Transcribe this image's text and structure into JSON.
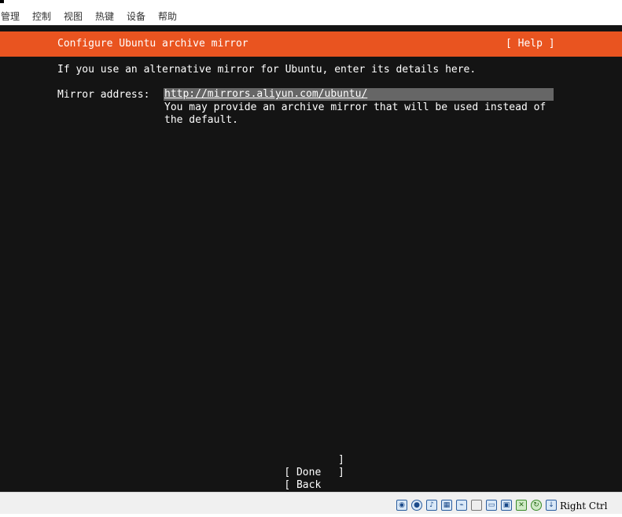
{
  "menubar": {
    "items": [
      "管理",
      "控制",
      "视图",
      "热键",
      "设备",
      "帮助"
    ]
  },
  "installer": {
    "title": "Configure Ubuntu archive mirror",
    "help_label": "[ Help ]",
    "intro": "If you use an alternative mirror for Ubuntu, enter its details here.",
    "mirror_label": "Mirror address:",
    "mirror_value": "http://mirrors.aliyun.com/ubuntu/",
    "mirror_help_line1": "You may provide an archive mirror that will be used instead of",
    "mirror_help_line2": "the default.",
    "done_label": "[ Done",
    "back_label": "[ Back",
    "bracket_close": "]",
    "accent_color": "#e95420"
  },
  "statusbar": {
    "icons": [
      "hard-disk-icon",
      "optical-disk-icon",
      "audio-icon",
      "network-icon",
      "usb-icon",
      "shared-folders-icon",
      "display-icon",
      "video-capture-icon",
      "recording-icon",
      "cpu-activity-icon",
      "mouse-integration-icon",
      "keyboard-icon"
    ],
    "host_key": "Right Ctrl"
  }
}
